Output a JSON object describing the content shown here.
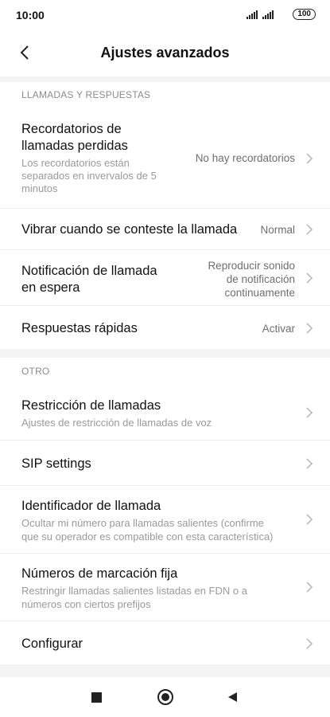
{
  "status": {
    "time": "10:00",
    "battery": "100"
  },
  "header": {
    "title": "Ajustes avanzados"
  },
  "sections": [
    {
      "label": "LLAMADAS Y RESPUESTAS",
      "rows": [
        {
          "title_l1": "Recordatorios de",
          "title_l2": "llamadas perdidas",
          "sub_l1": "Los recordatorios están",
          "sub_l2": "separados en invervalos de 5",
          "sub_l3": "minutos",
          "value": "No hay recordatorios"
        },
        {
          "title": "Vibrar cuando se conteste la llamada",
          "value": "Normal"
        },
        {
          "title_l1": "Notificación de llamada",
          "title_l2": "en espera",
          "value_l1": "Reproducir sonido",
          "value_l2": "de notificación",
          "value_l3": "continuamente"
        },
        {
          "title": "Respuestas rápidas",
          "value": "Activar"
        }
      ]
    },
    {
      "label": "OTRO",
      "rows": [
        {
          "title": "Restricción de llamadas",
          "sub": "Ajustes de restricción de llamadas de voz"
        },
        {
          "title": "SIP settings"
        },
        {
          "title": "Identificador de llamada",
          "sub_l1": "Ocultar mi número para llamadas salientes (confirme",
          "sub_l2": "que su operador es compatible con esta característica)"
        },
        {
          "title": "Números de marcación fija",
          "sub_l1": "Restringir llamadas salientes listadas en FDN o a",
          "sub_l2": "números con ciertos prefijos"
        },
        {
          "title": "Configurar"
        }
      ]
    }
  ],
  "icons": {
    "back": "chevron-left-icon",
    "row_arrow": "chevron-right-icon",
    "nav_recents": "square-icon",
    "nav_home": "circle-icon",
    "nav_back": "triangle-left-icon"
  },
  "colors": {
    "background": "#f4f4f4",
    "surface": "#ffffff",
    "secondary_text": "#9a9a9a"
  }
}
